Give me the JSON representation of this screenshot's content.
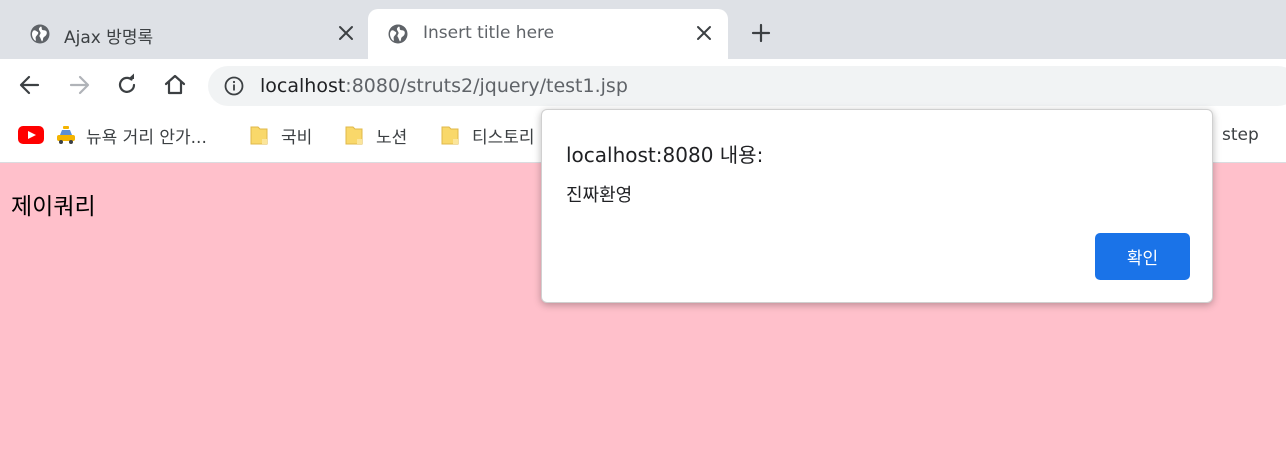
{
  "browser": {
    "tabs": [
      {
        "title": "Ajax 방명록",
        "active": false
      },
      {
        "title": "Insert title here",
        "active": true
      }
    ],
    "address": {
      "host": "localhost",
      "rest": ":8080/struts2/jquery/test1.jsp"
    },
    "bookmarks": [
      {
        "label": "뉴욕 거리 안가...",
        "icon": "taxi-icon"
      },
      {
        "label": "국비",
        "icon": "folder-icon"
      },
      {
        "label": "노션",
        "icon": "folder-icon"
      },
      {
        "label": "티스토리",
        "icon": "folder-icon"
      },
      {
        "label": "step",
        "icon": "folder-icon"
      }
    ],
    "colors": {
      "tabstrip": "#dee1e6",
      "omnibox": "#f1f3f4",
      "page_background": "#ffc0cb",
      "dialog_button": "#1a73e8",
      "youtube": "#ff0000",
      "folder": "#f9d86a"
    }
  },
  "page": {
    "heading": "제이쿼리"
  },
  "dialog": {
    "title": "localhost:8080 내용:",
    "message": "진짜환영",
    "ok_label": "확인"
  }
}
